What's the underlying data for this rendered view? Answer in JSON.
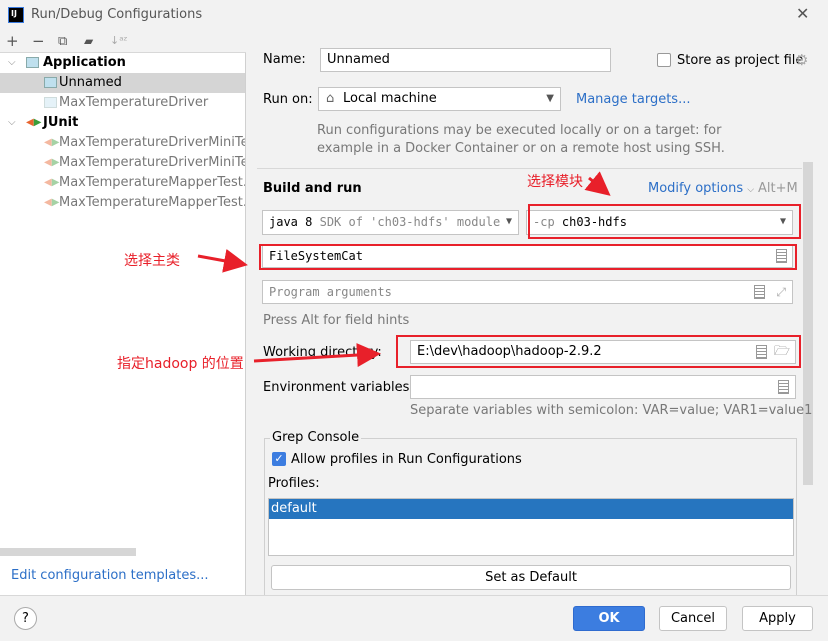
{
  "window": {
    "title": "Run/Debug Configurations",
    "logo": "IJ"
  },
  "toolbar": {
    "add": "+",
    "remove": "−",
    "copy": "⧉",
    "folder": "▰",
    "sort": "↓ᵃᶻ"
  },
  "tree": [
    {
      "label": "Application",
      "type": "group",
      "bold": true
    },
    {
      "label": "Unnamed",
      "type": "app",
      "selected": true
    },
    {
      "label": "MaxTemperatureDriver",
      "type": "app",
      "faded": true
    },
    {
      "label": "JUnit",
      "type": "group-junit",
      "bold": true
    },
    {
      "label": "MaxTemperatureDriverMiniTest",
      "type": "junit",
      "faded": true
    },
    {
      "label": "MaxTemperatureDriverMiniTest.",
      "type": "junit",
      "faded": true
    },
    {
      "label": "MaxTemperatureMapperTest.ig",
      "type": "junit",
      "faded": true
    },
    {
      "label": "MaxTemperatureMapperTest.pr",
      "type": "junit",
      "faded": true
    }
  ],
  "edit_templates": "Edit configuration templates...",
  "form": {
    "name_label": "Name:",
    "name_value": "Unnamed",
    "store_label": "Store as project file",
    "run_on_label": "Run on:",
    "run_on_value": "Local machine",
    "manage_targets": "Manage targets...",
    "run_on_hint1": "Run configurations may be executed locally or on a target: for",
    "run_on_hint2": "example in a Docker Container or on a remote host using SSH.",
    "build_run": "Build and run",
    "modify_options": "Modify options",
    "modify_shortcut": "Alt+M",
    "jdk_main": "java 8",
    "jdk_sub": "SDK of 'ch03-hdfs' module",
    "cp_prefix": "-cp",
    "cp_value": "ch03-hdfs",
    "main_class": "FileSystemCat",
    "program_args_placeholder": "Program arguments",
    "field_hints": "Press Alt for field hints",
    "workdir_label": "Working directory:",
    "workdir_value": "E:\\dev\\hadoop\\hadoop-2.9.2",
    "env_label": "Environment variables:",
    "env_value": "",
    "env_hint": "Separate variables with semicolon: VAR=value; VAR1=value1"
  },
  "grep": {
    "title": "Grep Console",
    "allow_label": "Allow profiles in Run Configurations",
    "allow_checked": true,
    "profiles_label": "Profiles:",
    "profiles": [
      "default"
    ],
    "set_default": "Set as Default"
  },
  "annotations": {
    "module": "选择模块",
    "main": "选择主类",
    "hadoop": "指定hadoop 的位置"
  },
  "buttons": {
    "help": "?",
    "ok": "OK",
    "cancel": "Cancel",
    "apply": "Apply"
  },
  "colors": {
    "accent": "#3c7de0",
    "annotation": "#e8202a",
    "link": "#2c6fc7",
    "selection": "#2675bf"
  }
}
